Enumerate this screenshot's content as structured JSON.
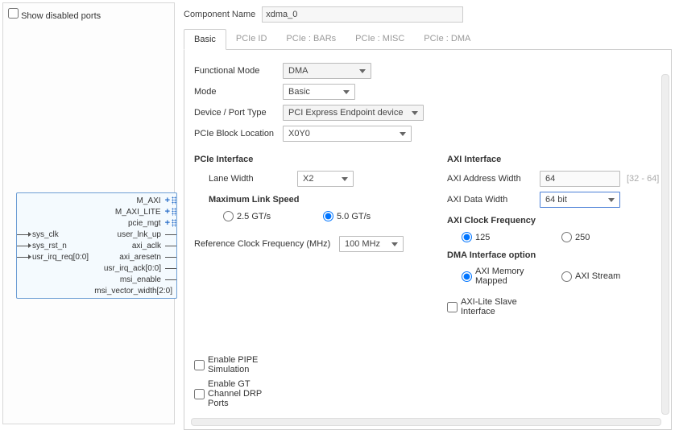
{
  "left": {
    "show_disabled_ports_label": "Show disabled ports",
    "ports_right_bus": [
      "M_AXI",
      "M_AXI_LITE",
      "pcie_mgt"
    ],
    "ports_left": [
      "sys_clk",
      "sys_rst_n",
      "usr_irq_req[0:0]"
    ],
    "ports_right": [
      "user_lnk_up",
      "axi_aclk",
      "axi_aresetn",
      "usr_irq_ack[0:0]",
      "msi_enable",
      "msi_vector_width[2:0]"
    ]
  },
  "header": {
    "component_name_label": "Component Name",
    "component_name_value": "xdma_0"
  },
  "tabs": [
    "Basic",
    "PCIe ID",
    "PCIe : BARs",
    "PCIe : MISC",
    "PCIe : DMA"
  ],
  "basic": {
    "functional_mode_label": "Functional Mode",
    "functional_mode_value": "DMA",
    "mode_label": "Mode",
    "mode_value": "Basic",
    "device_port_type_label": "Device / Port Type",
    "device_port_type_value": "PCI Express Endpoint device",
    "pcie_block_loc_label": "PCIe Block Location",
    "pcie_block_loc_value": "X0Y0",
    "pcie": {
      "section": "PCIe Interface",
      "lane_width_label": "Lane Width",
      "lane_width_value": "X2",
      "max_link_speed_label": "Maximum Link Speed",
      "speed_25": "2.5 GT/s",
      "speed_50": "5.0 GT/s",
      "refclk_label": "Reference Clock Frequency (MHz)",
      "refclk_value": "100 MHz"
    },
    "axi": {
      "section": "AXI Interface",
      "addr_width_label": "AXI Address Width",
      "addr_width_value": "64",
      "addr_width_hint": "[32 - 64]",
      "data_width_label": "AXI Data Width",
      "data_width_value": "64 bit",
      "clk_section": "AXI Clock Frequency",
      "clk_125": "125",
      "clk_250": "250",
      "dma_section": "DMA Interface option",
      "mm": "AXI Memory Mapped",
      "stream": "AXI Stream",
      "axilite_label": "AXI-Lite Slave Interface"
    },
    "pipe_label": "Enable PIPE Simulation",
    "drp_label": "Enable GT Channel DRP Ports"
  }
}
